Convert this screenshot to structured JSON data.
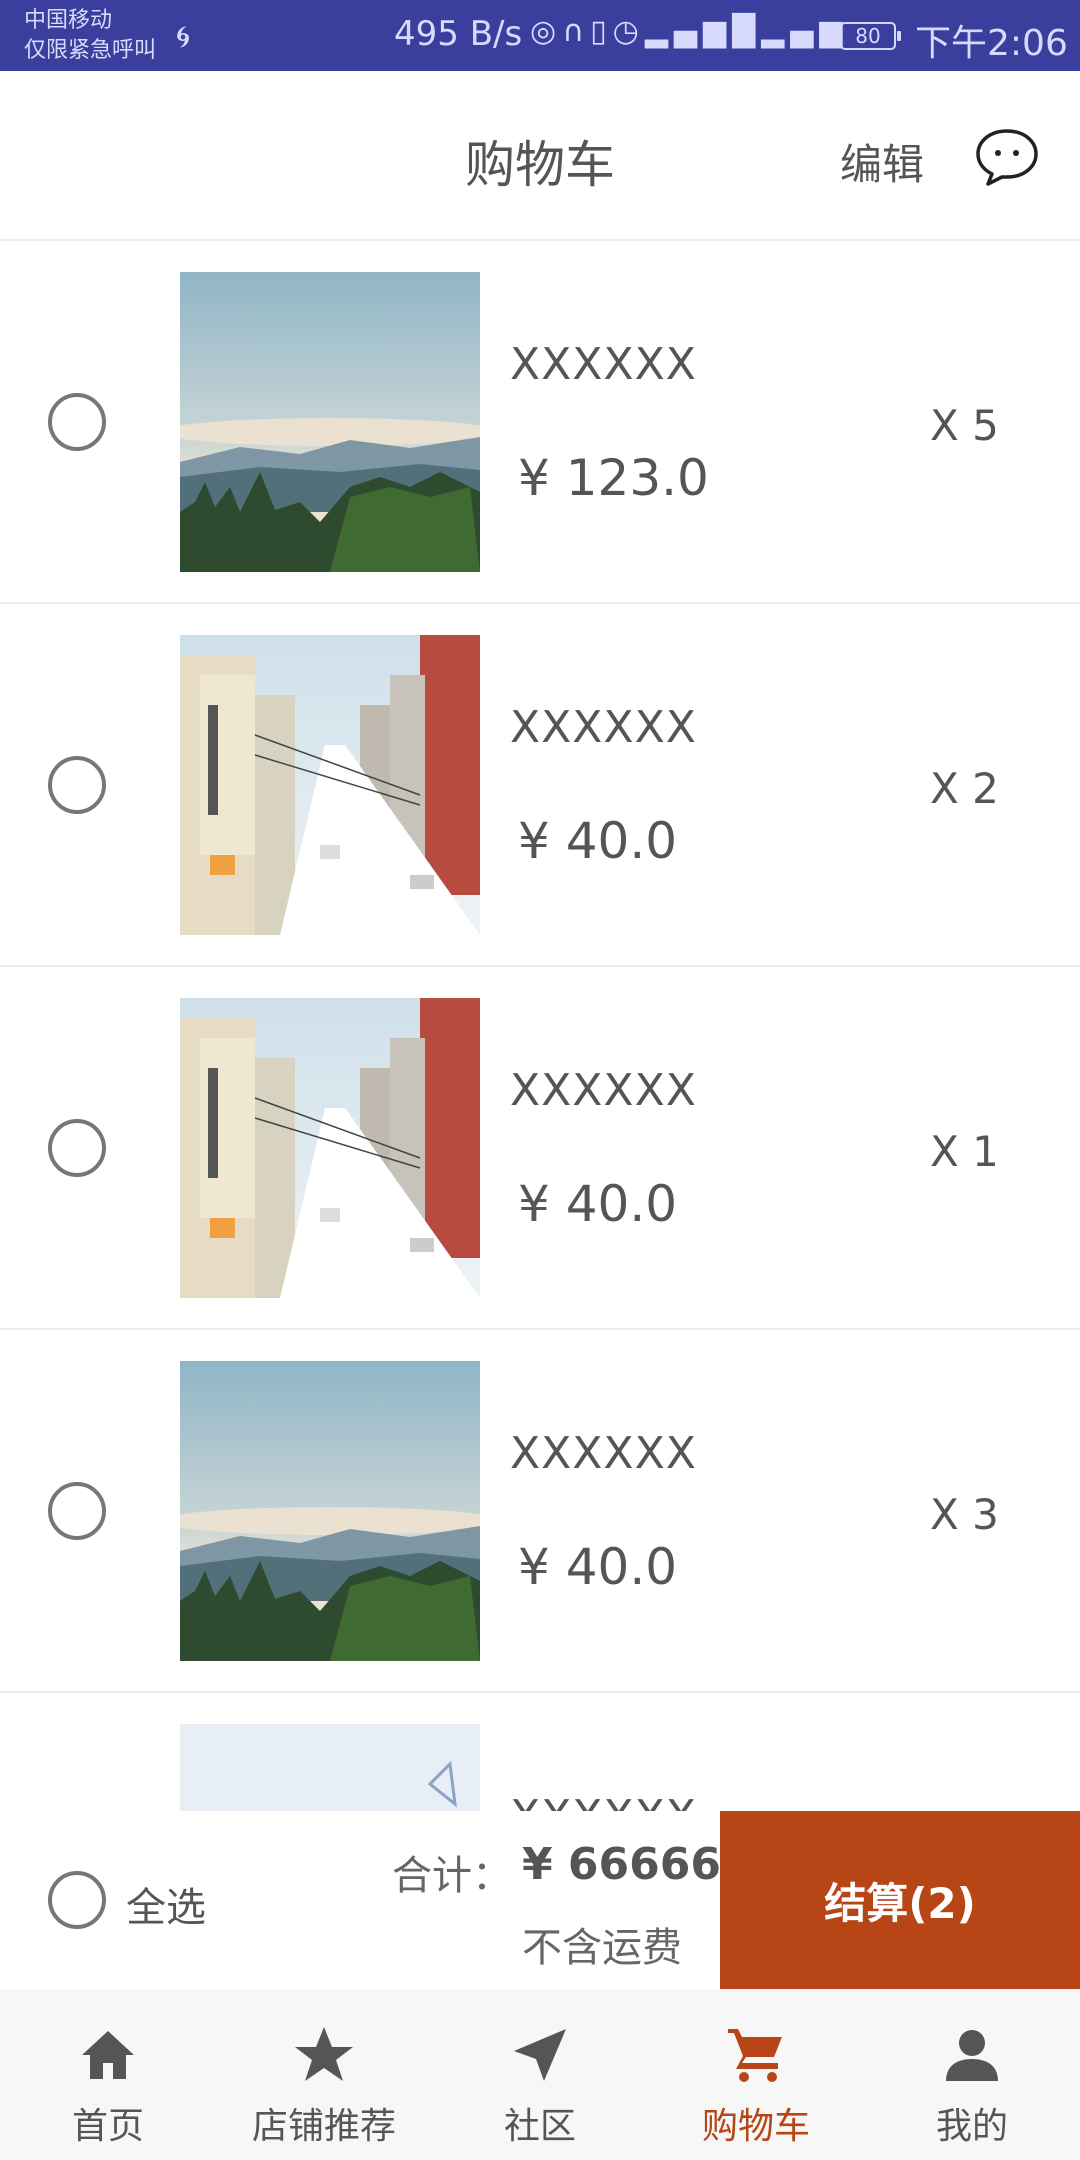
{
  "status_bar": {
    "carrier_line1": "中国移动",
    "carrier_line2": "仅限紧急呼叫",
    "net_speed": "495 B/s",
    "battery": "80",
    "time": "下午2:06"
  },
  "header": {
    "title": "购物车",
    "edit_label": "编辑",
    "chat_icon": "chat-bubble-icon"
  },
  "cart": {
    "items": [
      {
        "name": "XXXXXX",
        "price": "¥ 123.0",
        "qty": "X 5",
        "image": "mountain-landscape"
      },
      {
        "name": "XXXXXX",
        "price": "¥ 40.0",
        "qty": "X 2",
        "image": "snowy-street"
      },
      {
        "name": "XXXXXX",
        "price": "¥ 40.0",
        "qty": "X 1",
        "image": "snowy-street"
      },
      {
        "name": "XXXXXX",
        "price": "¥ 40.0",
        "qty": "X 3",
        "image": "mountain-landscape"
      },
      {
        "name": "XXXXXX",
        "price": "",
        "qty": "",
        "image": "snowy-sky"
      }
    ]
  },
  "summary": {
    "select_all_label": "全选",
    "total_label": "合计：",
    "total_value": "¥ 66666",
    "shipping_note": "不含运费",
    "checkout_label": "结算(2)"
  },
  "tabs": [
    {
      "label": "首页",
      "icon": "home-icon"
    },
    {
      "label": "店铺推荐",
      "icon": "star-icon"
    },
    {
      "label": "社区",
      "icon": "navigation-icon"
    },
    {
      "label": "购物车",
      "icon": "cart-icon",
      "active": true
    },
    {
      "label": "我的",
      "icon": "person-icon"
    }
  ],
  "colors": {
    "status_bar": "#3a3f9e",
    "accent": "#b84516",
    "text": "#555555"
  }
}
